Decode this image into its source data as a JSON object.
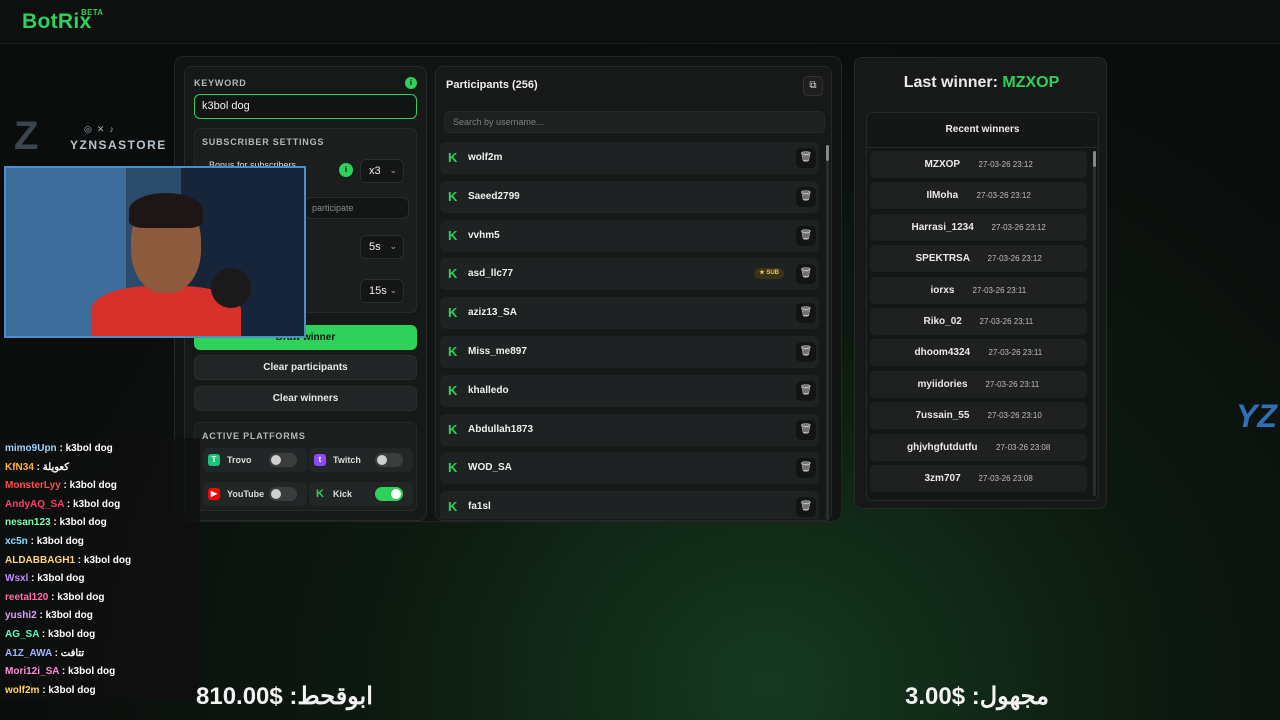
{
  "app": {
    "name": "BotRix",
    "badge": "BETA"
  },
  "left": {
    "keyword_label": "KEYWORD",
    "keyword_value": "k3bol dog",
    "subscriber_label": "SUBSCRIBER SETTINGS",
    "bonus_label": "Bonus for subscribers",
    "bonus_value": "x3",
    "participate_placeholder": "participate",
    "timer1_value": "5s",
    "timer2_value": "15s",
    "draw_button": "Draw winner",
    "clear_participants": "Clear participants",
    "clear_winners": "Clear winners",
    "platforms_label": "ACTIVE PLATFORMS",
    "platforms": [
      {
        "name": "Trovo",
        "enabled": false,
        "color": "#19c57a"
      },
      {
        "name": "Twitch",
        "enabled": false,
        "color": "#9146ff"
      },
      {
        "name": "YouTube",
        "enabled": false,
        "color": "#ff0000"
      },
      {
        "name": "Kick",
        "enabled": true,
        "color": "#2ed15a"
      }
    ]
  },
  "participants": {
    "title": "Participants (256)",
    "search_placeholder": "Search by username...",
    "items": [
      {
        "name": "wolf2m",
        "sub": false
      },
      {
        "name": "Saeed2799",
        "sub": false
      },
      {
        "name": "vvhm5",
        "sub": false
      },
      {
        "name": "asd_llc77",
        "sub": true
      },
      {
        "name": "aziz13_SA",
        "sub": false
      },
      {
        "name": "Miss_me897",
        "sub": false
      },
      {
        "name": "khalledo",
        "sub": false
      },
      {
        "name": "Abdullah1873",
        "sub": false
      },
      {
        "name": "WOD_SA",
        "sub": false
      },
      {
        "name": "fa1sl",
        "sub": false
      }
    ],
    "sub_badge": "★ SUB"
  },
  "winners": {
    "last_prefix": "Last winner:",
    "last_name": "MZXOP",
    "recent_title": "Recent winners",
    "items": [
      {
        "name": "MZXOP",
        "time": "27-03-26 23:12"
      },
      {
        "name": "IlMoha",
        "time": "27-03-26 23:12"
      },
      {
        "name": "Harrasi_1234",
        "time": "27-03-26 23:12"
      },
      {
        "name": "SPEKTRSA",
        "time": "27-03-26 23:12"
      },
      {
        "name": "iorxs",
        "time": "27-03-26 23:11"
      },
      {
        "name": "Riko_02",
        "time": "27-03-26 23:11"
      },
      {
        "name": "dhoom4324",
        "time": "27-03-26 23:11"
      },
      {
        "name": "myiidories",
        "time": "27-03-26 23:11"
      },
      {
        "name": "7ussain_55",
        "time": "27-03-26 23:10"
      },
      {
        "name": "ghjvhgfutdutfu",
        "time": "27-03-26 23:08"
      },
      {
        "name": "3zm707",
        "time": "27-03-26 23:08"
      }
    ]
  },
  "overlay": {
    "brand": "YZNSASTORE",
    "brand_icons": "◎✕♪",
    "chat": [
      {
        "user": "mimo9Upn",
        "color": "#9fd3ff",
        "msg": "k3bol dog"
      },
      {
        "user": "KfN34",
        "color": "#ffb347",
        "msg": "كعويلة"
      },
      {
        "user": "MonsterLyy",
        "color": "#ff4d4d",
        "msg": "k3bol dog"
      },
      {
        "user": "AndyAQ_SA",
        "color": "#ff3b6b",
        "msg": "k3bol dog"
      },
      {
        "user": "nesan123",
        "color": "#7dffb0",
        "msg": "k3bol dog"
      },
      {
        "user": "xc5n",
        "color": "#7fe3ff",
        "msg": "k3bol dog"
      },
      {
        "user": "ALDABBAGH1",
        "color": "#ffd27f",
        "msg": "k3bol dog"
      },
      {
        "user": "Wsxl",
        "color": "#c58aff",
        "msg": "k3bol dog"
      },
      {
        "user": "reetal120",
        "color": "#ff6fa5",
        "msg": "k3bol dog"
      },
      {
        "user": "yushi2",
        "color": "#e59cff",
        "msg": "k3bol dog"
      },
      {
        "user": "AG_SA",
        "color": "#5dffb5",
        "msg": "k3bol dog"
      },
      {
        "user": "A1Z_AWA",
        "color": "#9fb5ff",
        "msg": "تتافت"
      },
      {
        "user": "Mori12i_SA",
        "color": "#ff8ad8",
        "msg": "k3bol dog"
      },
      {
        "user": "wolf2m",
        "color": "#ffd45a",
        "msg": "k3bol dog"
      }
    ],
    "donation_left": "ابوقحط: $810.00",
    "donation_right": "مجهول: $3.00"
  }
}
